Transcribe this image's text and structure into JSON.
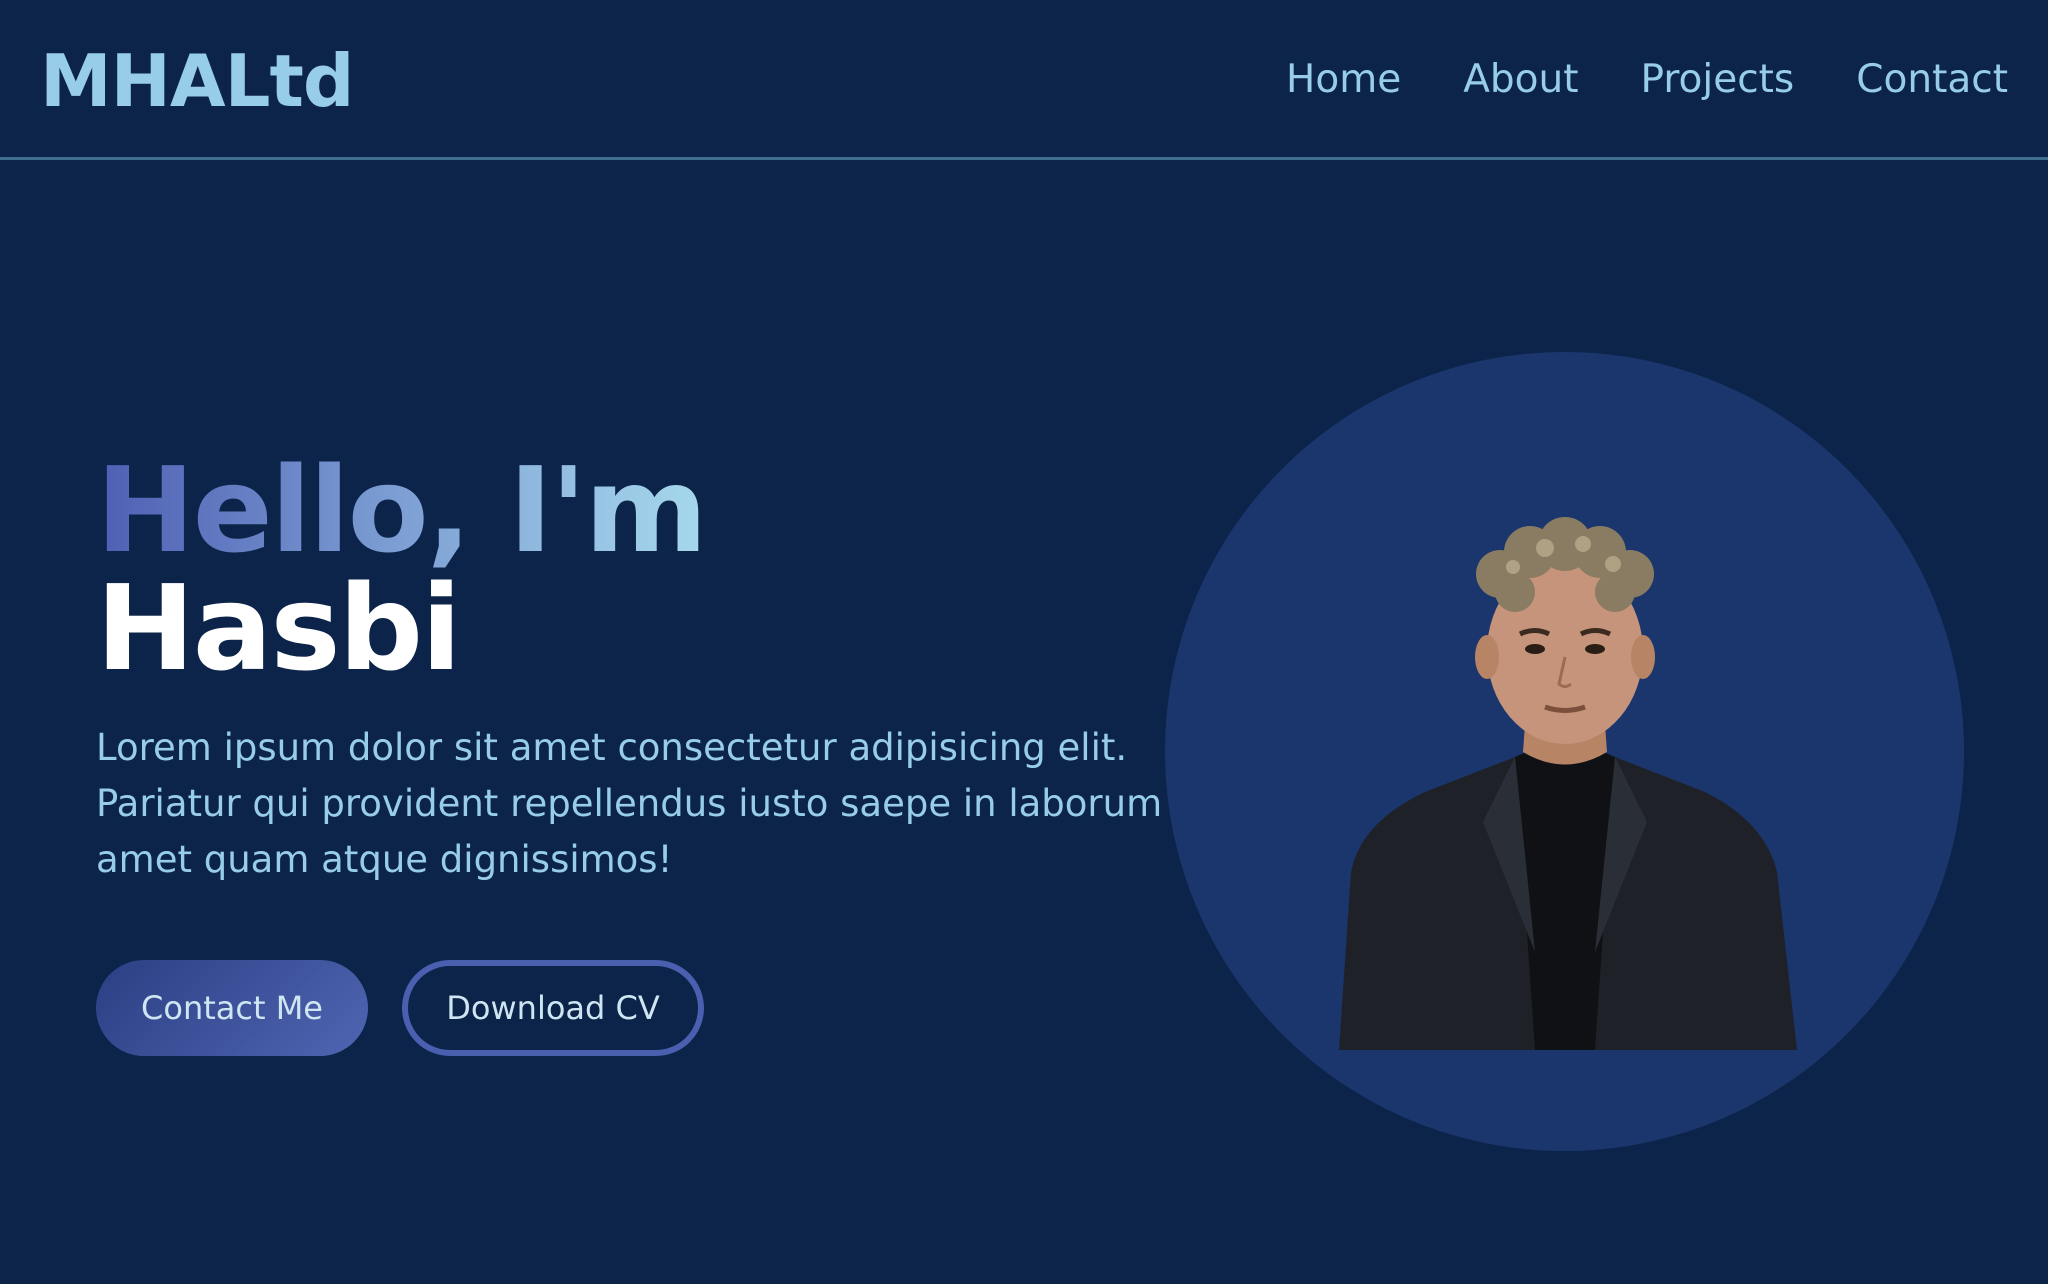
{
  "brand": {
    "logo_text": "MHALtd"
  },
  "nav": {
    "items": [
      {
        "label": "Home"
      },
      {
        "label": "About"
      },
      {
        "label": "Projects"
      },
      {
        "label": "Contact"
      }
    ]
  },
  "hero": {
    "greeting": "Hello, I'm",
    "name": "Hasbi",
    "description": "Lorem ipsum dolor sit amet consectetur adipisicing elit. Pariatur qui provident repellendus iusto saepe in laborum amet quam atque dignissimos!",
    "primary_button": "Contact Me",
    "secondary_button": "Download CV"
  },
  "colors": {
    "background": "#0c2449",
    "accent_light": "#97cde6",
    "accent_blue": "#4f5fb4",
    "circle_bg": "#1a366d"
  }
}
